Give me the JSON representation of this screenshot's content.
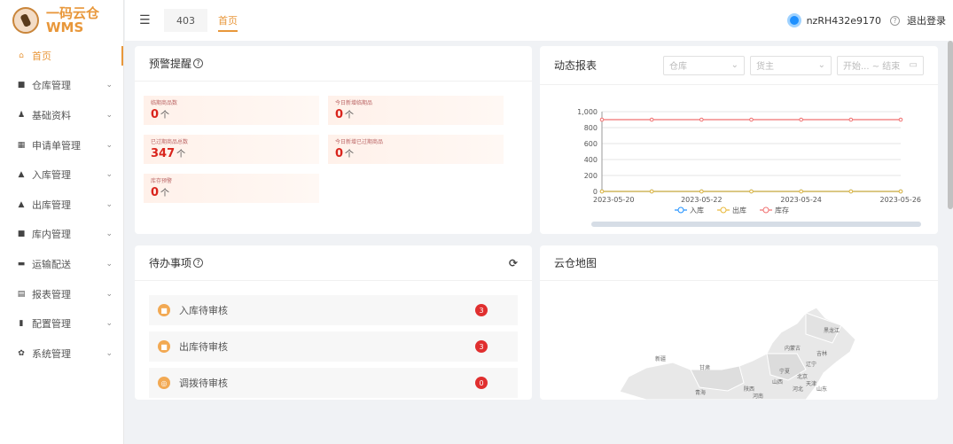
{
  "app": {
    "logo_line1": "一码云仓",
    "logo_line2": "WMS"
  },
  "sidebar": {
    "items": [
      {
        "label": "首页",
        "icon": "home-icon",
        "glyph": "⌂",
        "active": true,
        "has_children": false
      },
      {
        "label": "仓库管理",
        "icon": "warehouse-icon",
        "glyph": "■",
        "has_children": true
      },
      {
        "label": "基础资料",
        "icon": "user-icon",
        "glyph": "♟",
        "has_children": true
      },
      {
        "label": "申请单管理",
        "icon": "form-icon",
        "glyph": "▦",
        "has_children": true
      },
      {
        "label": "入库管理",
        "icon": "inbound-icon",
        "glyph": "▲",
        "has_children": true
      },
      {
        "label": "出库管理",
        "icon": "outbound-icon",
        "glyph": "▲",
        "has_children": true
      },
      {
        "label": "库内管理",
        "icon": "inventory-icon",
        "glyph": "■",
        "has_children": true
      },
      {
        "label": "运输配送",
        "icon": "truck-icon",
        "glyph": "▬",
        "has_children": true
      },
      {
        "label": "报表管理",
        "icon": "report-icon",
        "glyph": "▤",
        "has_children": true
      },
      {
        "label": "配置管理",
        "icon": "bookmark-icon",
        "glyph": "▮",
        "has_children": true
      },
      {
        "label": "系统管理",
        "icon": "gear-icon",
        "glyph": "✿",
        "has_children": true
      }
    ]
  },
  "topbar": {
    "tabs": [
      {
        "label": "403"
      },
      {
        "label": "首页"
      }
    ],
    "username": "nzRH432e9170",
    "logout": "退出登录"
  },
  "alert_panel": {
    "title": "预警提醒",
    "boxes": [
      {
        "label": "临期商品数",
        "value": "0",
        "unit": "个"
      },
      {
        "label": "今日新增临期品",
        "value": "0",
        "unit": "个"
      },
      {
        "label": "已过期商品总数",
        "value": "347",
        "unit": "个"
      },
      {
        "label": "今日新增已过期商品",
        "value": "0",
        "unit": "个"
      },
      {
        "label": "库存预警",
        "value": "0",
        "unit": "个"
      }
    ]
  },
  "chart_panel": {
    "title": "动态报表",
    "warehouse_placeholder": "仓库",
    "owner_placeholder": "货主",
    "date_placeholder": "开始... ~ 结束",
    "colors": {
      "inbound": "#1e90ff",
      "outbound": "#e8b83a",
      "stock": "#f07070"
    }
  },
  "chart_data": {
    "type": "line",
    "x": [
      "2023-05-20",
      "2023-05-21",
      "2023-05-22",
      "2023-05-23",
      "2023-05-24",
      "2023-05-25",
      "2023-05-26"
    ],
    "x_tick_labels": [
      "2023-05-20",
      "2023-05-22",
      "2023-05-24",
      "2023-05-26"
    ],
    "y_tick_labels": [
      "0",
      "200",
      "400",
      "600",
      "800",
      "1,000"
    ],
    "ylim": [
      0,
      1000
    ],
    "series": [
      {
        "name": "入库",
        "values": [
          0,
          0,
          0,
          0,
          0,
          0,
          0
        ]
      },
      {
        "name": "出库",
        "values": [
          0,
          0,
          0,
          0,
          0,
          0,
          0
        ]
      },
      {
        "name": "库存",
        "values": [
          900,
          900,
          900,
          900,
          900,
          900,
          900
        ]
      }
    ],
    "legend_position": "bottom",
    "grid": true
  },
  "todo_panel": {
    "title": "待办事项",
    "items": [
      {
        "label": "入库待审核",
        "count": "3"
      },
      {
        "label": "出库待审核",
        "count": "3"
      },
      {
        "label": "调拨待审核",
        "count": "0"
      }
    ]
  },
  "map_panel": {
    "title": "云仓地图",
    "regions": [
      "黑龙江",
      "内蒙古",
      "吉林",
      "辽宁",
      "新疆",
      "甘肃",
      "宁夏",
      "北京",
      "天津",
      "山西",
      "河北",
      "青海",
      "陕西",
      "山东",
      "河南"
    ]
  }
}
